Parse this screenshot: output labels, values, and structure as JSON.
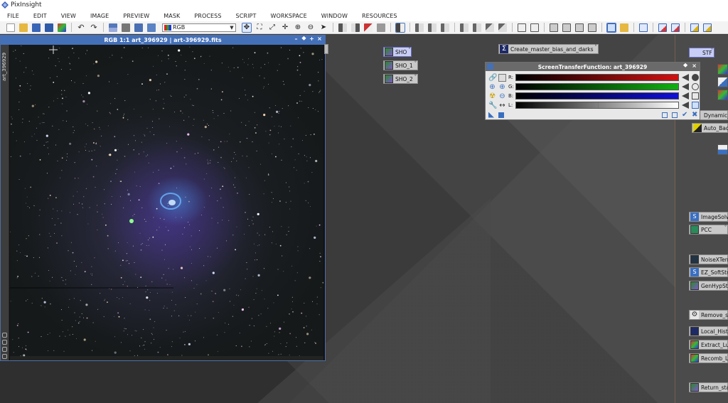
{
  "app": {
    "title": "PixInsight"
  },
  "menu": [
    "FILE",
    "EDIT",
    "VIEW",
    "IMAGE",
    "PREVIEW",
    "MASK",
    "PROCESS",
    "SCRIPT",
    "WORKSPACE",
    "WINDOW",
    "RESOURCES"
  ],
  "toolbar": {
    "view_select": "RGB"
  },
  "image_window": {
    "title": "RGB 1:1 art_396929 | art-396929.fits",
    "side_label": "art_396929",
    "controls": [
      "–",
      "⯁",
      "+",
      "×"
    ]
  },
  "stf": {
    "title": "ScreenTransferFunction: art_396929",
    "channels": [
      {
        "label": "R:",
        "color": "#d31010"
      },
      {
        "label": "G:",
        "color": "#10b010"
      },
      {
        "label": "B:",
        "color": "#1010d8"
      },
      {
        "label": "L:",
        "color": "#ffffff"
      }
    ]
  },
  "desktop_icons": [
    {
      "label": "SHO"
    },
    {
      "label": "SHO_1"
    },
    {
      "label": "SHO_2"
    },
    {
      "label": "Create_master_bias_and_darks"
    },
    {
      "label": "STF"
    },
    {
      "label": "Dynamic_c"
    },
    {
      "label": "Auto_Back"
    },
    {
      "label": "ImageSolve"
    },
    {
      "label": "PCC"
    },
    {
      "label": "NoiseXTermi"
    },
    {
      "label": "EZ_SoftStre"
    },
    {
      "label": "GenHypStre"
    },
    {
      "label": "Remove_sta"
    },
    {
      "label": "Local_Histo_"
    },
    {
      "label": "Extract_Lum"
    },
    {
      "label": "Recomb_Lur"
    },
    {
      "label": "Return_stars"
    }
  ],
  "colors": {
    "window_title": "#4470b8",
    "accent": "#4a78c0"
  }
}
